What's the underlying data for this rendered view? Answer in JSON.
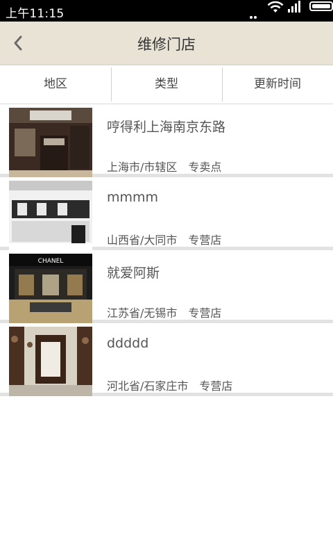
{
  "status_bar": {
    "time": "上午11:15"
  },
  "header": {
    "title": "维修门店"
  },
  "filters": [
    {
      "label": "地区"
    },
    {
      "label": "类型"
    },
    {
      "label": "更新时间"
    }
  ],
  "stores": [
    {
      "name": "哼得利上海南京东路",
      "region": "上海市/市辖区",
      "type": "专卖点",
      "thumb_color": "#3a2a22",
      "thumb_accent": "#c9b79c"
    },
    {
      "name": "mmmm",
      "region": "山西省/大同市",
      "type": "专营店",
      "thumb_color": "#2b2b2b",
      "thumb_accent": "#e8e8e8"
    },
    {
      "name": "就爱阿斯",
      "region": "江苏省/无锡市",
      "type": "专营店",
      "thumb_color": "#1c1c1c",
      "thumb_accent": "#d9b36a",
      "thumb_sign": "CHANEL"
    },
    {
      "name": "ddddd",
      "region": "河北省/石家庄市",
      "type": "专营店",
      "thumb_color": "#4a3020",
      "thumb_accent": "#d8d2c4"
    }
  ]
}
